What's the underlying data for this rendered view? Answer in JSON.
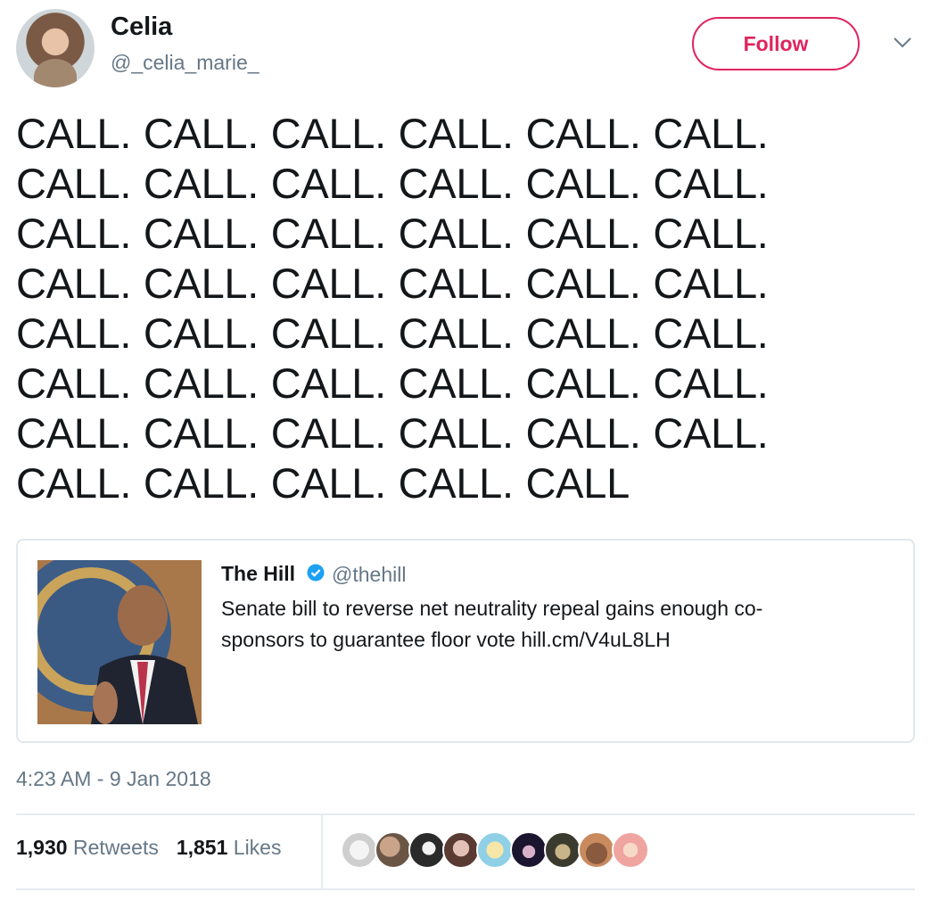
{
  "author": {
    "name": "Celia",
    "handle": "@_celia_marie_"
  },
  "follow": {
    "label": "Follow"
  },
  "tweet": {
    "lines": [
      "CALL. CALL. CALL. CALL. CALL. CALL.",
      "CALL. CALL. CALL. CALL. CALL. CALL.",
      "CALL. CALL. CALL. CALL. CALL. CALL.",
      "CALL. CALL. CALL. CALL. CALL. CALL.",
      "CALL. CALL. CALL. CALL. CALL. CALL.",
      "CALL. CALL. CALL. CALL. CALL. CALL.",
      "CALL. CALL. CALL. CALL. CALL. CALL.",
      "CALL. CALL. CALL. CALL. CALL"
    ]
  },
  "quote": {
    "author": "The Hill",
    "handle": "@thehill",
    "text": "Senate bill to reverse net neutrality repeal gains enough co-sponsors to guarantee floor vote hill.cm/V4uL8LH"
  },
  "timestamp": "4:23 AM - 9 Jan 2018",
  "stats": {
    "retweets_count": "1,930",
    "retweets_label": "Retweets",
    "likes_count": "1,851",
    "likes_label": "Likes"
  },
  "colors": {
    "accent": "#e0245e",
    "muted": "#657786",
    "verified": "#1da1f2"
  }
}
